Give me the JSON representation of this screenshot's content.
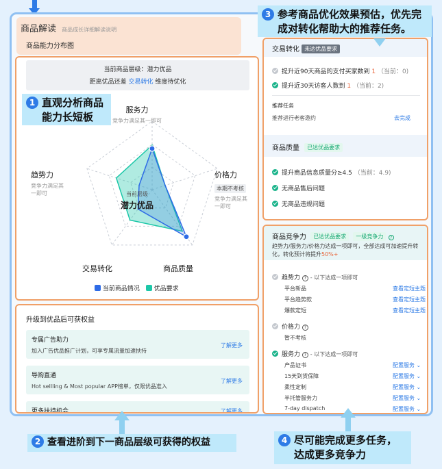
{
  "header": {
    "title": "商品解读",
    "subtitle": "商品成长详细解读说明",
    "section": "商品能力分布图"
  },
  "level": {
    "line1": "当前商品层级：潜力优品",
    "line2_pre": "距离优品还差",
    "line2_link": "交易转化",
    "line2_post": "维度待优化"
  },
  "radar": {
    "axes": [
      {
        "label": "服务力",
        "sub": "竞争力满足其一即可"
      },
      {
        "label": "价格力",
        "badge": "本期不考核",
        "sub": "竞争力满足其一即可"
      },
      {
        "label": "商品质量"
      },
      {
        "label": "交易转化"
      },
      {
        "label": "趋势力",
        "sub": "竞争力满足其一即可"
      }
    ],
    "center_small": "当前层级",
    "center_big": "潜力优品",
    "legend": [
      "当前商品情况",
      "优品要求"
    ],
    "colors": {
      "current": "#2e6be6",
      "required": "#1cc7a8"
    },
    "current_values": [
      0.6,
      0.2,
      0.85,
      0.35,
      0.2
    ],
    "required_values": [
      0.65,
      0.2,
      0.75,
      0.55,
      0.55
    ]
  },
  "benefits": {
    "title": "升级到优品后可获权益",
    "items": [
      {
        "title": "专属广告助力",
        "desc": "加入广告优品推广计划，可享专属流量加速扶持",
        "link": "了解更多"
      },
      {
        "title": "导购直通",
        "desc": "Hot sellling & Most popular APP榜单，仅限优品准入",
        "link": "了解更多"
      },
      {
        "title": "更多扶持机会",
        "link": "了解更多"
      }
    ]
  },
  "trade": {
    "title": "交易转化",
    "badge": "未达优品要求",
    "tasks": [
      {
        "text": "提升近90天商品的支付买家数到",
        "target": "1",
        "current": "（当前：0)",
        "done": false
      },
      {
        "text": "提升近30天访客人数到",
        "target": "1",
        "current": "（当前：2)",
        "done": true
      }
    ],
    "recommend_title": "推荐任务",
    "recommend_item": "推荐进行老客邀约",
    "recommend_link": "去完成"
  },
  "quality": {
    "title": "商品质量",
    "badge": "已达优品要求",
    "tasks": [
      {
        "text": "提升商品信息质量分≥4.5",
        "current": "（当前：4.9)"
      },
      {
        "text": "无商品售后问题"
      },
      {
        "text": "无商品违规问题"
      }
    ]
  },
  "compete": {
    "title": "商品竞争力",
    "badge1": "已达优品要求",
    "badge2": "一级竞争力",
    "desc": "趋势力/服务力/价格力达成一项即可，全部达成可加速提升转化，转化预计将提升",
    "desc_pct": "50%+",
    "groups": [
      {
        "title": "趋势力",
        "hint": "- 以下达成一项即可",
        "done": false,
        "items": [
          {
            "name": "平台新品",
            "link": "查看定短主题"
          },
          {
            "name": "平台趋势款",
            "link": "查看定短主题"
          },
          {
            "name": "爆款定短",
            "link": "查看定短主题"
          }
        ]
      },
      {
        "title": "价格力",
        "hint": "",
        "done": false,
        "items": [
          {
            "name": "暂不考核",
            "link": ""
          }
        ]
      },
      {
        "title": "服务力",
        "hint": "- 以下达成一项即可",
        "done": true,
        "items": [
          {
            "name": "产品证书",
            "link": "配置服务"
          },
          {
            "name": "15天到货保障",
            "link": "配置服务"
          },
          {
            "name": "柔性定制",
            "link": "配置服务"
          },
          {
            "name": "半托管服务力",
            "link": "配置服务"
          },
          {
            "name": "7-day dispatch",
            "link": "配置服务"
          }
        ]
      }
    ]
  },
  "notes": {
    "n1": {
      "num": "1",
      "line1": "直观分析商品",
      "line2": "能力长短板"
    },
    "n2": {
      "num": "2",
      "text": "查看进阶到下一商品层级可获得的权益"
    },
    "n3": {
      "num": "3",
      "line1": "参考商品优化效果预估，优先完",
      "line2": "成对转化帮助大的推荐任务。"
    },
    "n4": {
      "num": "4",
      "line1": "尽可能完成更多任务，",
      "line2": "达成更多竞争力"
    }
  }
}
